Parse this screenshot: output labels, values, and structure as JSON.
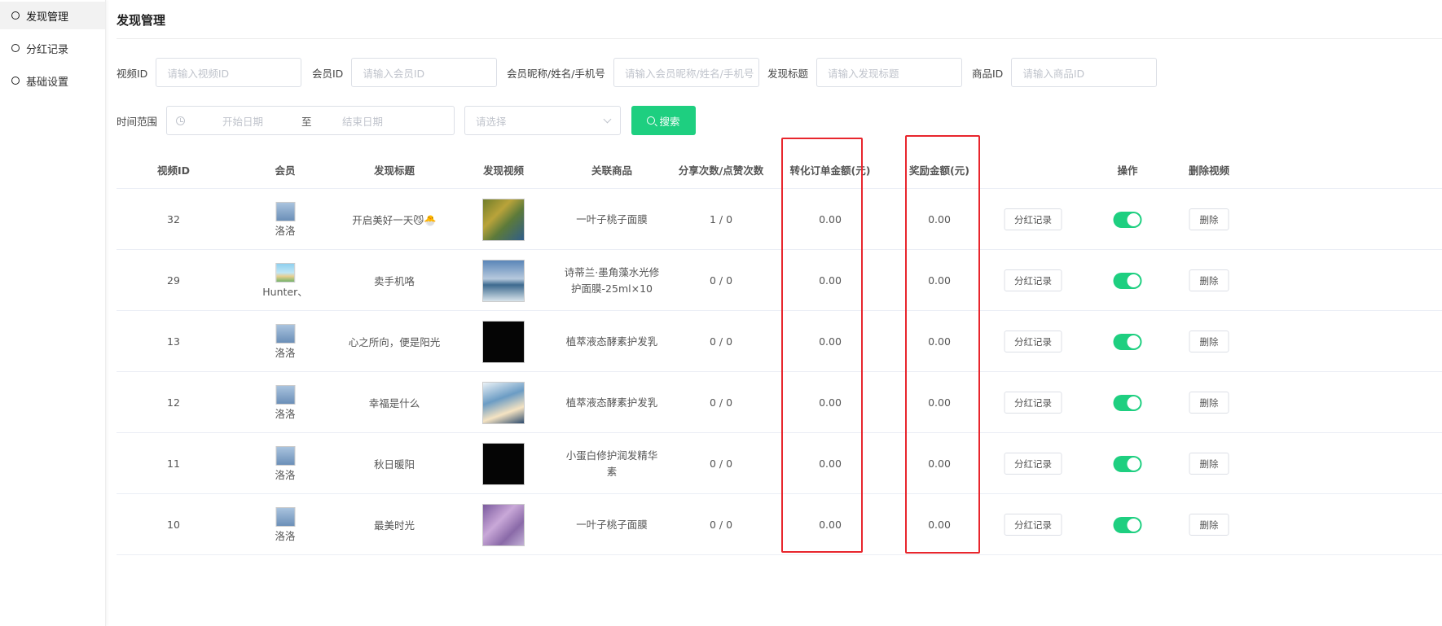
{
  "sidebar": {
    "items": [
      {
        "label": "发现管理",
        "active": true
      },
      {
        "label": "分红记录",
        "active": false
      },
      {
        "label": "基础设置",
        "active": false
      }
    ]
  },
  "page": {
    "title": "发现管理"
  },
  "filters": {
    "video_id": {
      "label": "视频ID",
      "placeholder": "请输入视频ID"
    },
    "member_id": {
      "label": "会员ID",
      "placeholder": "请输入会员ID"
    },
    "member_info": {
      "label": "会员昵称/姓名/手机号",
      "placeholder": "请输入会员昵称/姓名/手机号"
    },
    "title": {
      "label": "发现标题",
      "placeholder": "请输入发现标题"
    },
    "goods_id": {
      "label": "商品ID",
      "placeholder": "请输入商品ID"
    },
    "time_range": {
      "label": "时间范围",
      "start_placeholder": "开始日期",
      "separator": "至",
      "end_placeholder": "结束日期"
    },
    "select": {
      "placeholder": "请选择"
    },
    "search_button": "搜索"
  },
  "table": {
    "headers": [
      "视频ID",
      "会员",
      "发现标题",
      "发现视频",
      "关联商品",
      "分享次数/点赞次数",
      "转化订单金额(元)",
      "奖励金额(元)",
      "操作",
      "删除视频"
    ],
    "dividend_button": "分红记录",
    "delete_button": "删除",
    "rows": [
      {
        "id": "32",
        "member": "洛洛",
        "avatar": "person",
        "title": "开启美好一天😼🐣",
        "thumb": "yellow",
        "goods": [
          "一叶子桃子面膜"
        ],
        "share_like": "1 / 0",
        "order_amount": "0.00",
        "reward": "0.00",
        "enabled": true
      },
      {
        "id": "29",
        "member": "Hunter、",
        "avatar": "beach",
        "title": "卖手机咯",
        "thumb": "mountain",
        "goods": [
          "诗蒂兰·墨角藻水光修",
          "护面膜-25ml×10"
        ],
        "share_like": "0 / 0",
        "order_amount": "0.00",
        "reward": "0.00",
        "enabled": true
      },
      {
        "id": "13",
        "member": "洛洛",
        "avatar": "person",
        "title": "心之所向，便是阳光",
        "thumb": "black",
        "goods": [
          "植萃液态酵素护发乳"
        ],
        "share_like": "0 / 0",
        "order_amount": "0.00",
        "reward": "0.00",
        "enabled": true
      },
      {
        "id": "12",
        "member": "洛洛",
        "avatar": "person",
        "title": "幸福是什么",
        "thumb": "sky",
        "goods": [
          "植萃液态酵素护发乳"
        ],
        "share_like": "0 / 0",
        "order_amount": "0.00",
        "reward": "0.00",
        "enabled": true
      },
      {
        "id": "11",
        "member": "洛洛",
        "avatar": "person",
        "title": "秋日暖阳",
        "thumb": "black",
        "goods": [
          "小蛋白修护润发精华",
          "素"
        ],
        "share_like": "0 / 0",
        "order_amount": "0.00",
        "reward": "0.00",
        "enabled": true
      },
      {
        "id": "10",
        "member": "洛洛",
        "avatar": "person",
        "title": "最美时光",
        "thumb": "purple",
        "goods": [
          "一叶子桃子面膜"
        ],
        "share_like": "0 / 0",
        "order_amount": "0.00",
        "reward": "0.00",
        "enabled": true
      }
    ]
  },
  "colors": {
    "accent": "#1ecf80",
    "highlight_box": "#e8262d"
  }
}
